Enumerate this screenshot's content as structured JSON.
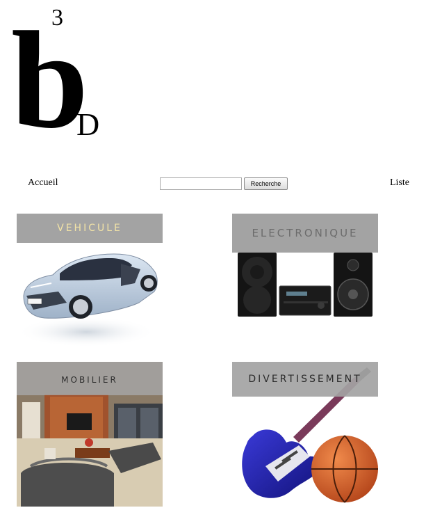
{
  "logo": {
    "main_letter": "b",
    "superscript": "3",
    "subscript": "D"
  },
  "nav": {
    "home": "Accueil",
    "list": "Liste"
  },
  "search": {
    "value": "",
    "placeholder": "",
    "button_label": "Recherche"
  },
  "categories": [
    {
      "label": "VEHICULE",
      "image": "car"
    },
    {
      "label": "ELECTRONIQUE",
      "image": "stereo-system"
    },
    {
      "label": "MOBILIER",
      "image": "living-room"
    },
    {
      "label": "DIVERTISSEMENT",
      "image": "guitar-and-basketball"
    }
  ]
}
